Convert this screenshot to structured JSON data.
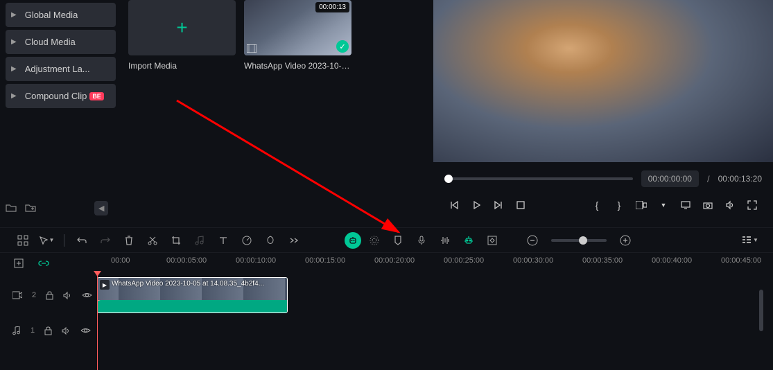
{
  "sidebar": {
    "items": [
      {
        "label": "Global Media"
      },
      {
        "label": "Cloud Media"
      },
      {
        "label": "Adjustment La..."
      },
      {
        "label": "Compound Clip"
      }
    ],
    "beta_badge": "BE"
  },
  "media": {
    "import_label": "Import Media",
    "clip": {
      "duration": "00:00:13",
      "name": "WhatsApp Video 2023-10-05..."
    }
  },
  "preview": {
    "current_time": "00:00:00:00",
    "separator": "/",
    "total_time": "00:00:13:20"
  },
  "timeline": {
    "ticks": [
      "00:00",
      "00:00:05:00",
      "00:00:10:00",
      "00:00:15:00",
      "00:00:20:00",
      "00:00:25:00",
      "00:00:30:00",
      "00:00:35:00",
      "00:00:40:00",
      "00:00:45:00"
    ],
    "track_video_id": "2",
    "track_audio_id": "1",
    "clip_name": "WhatsApp Video 2023-10-05 at 14.08.35_4b2f4..."
  }
}
